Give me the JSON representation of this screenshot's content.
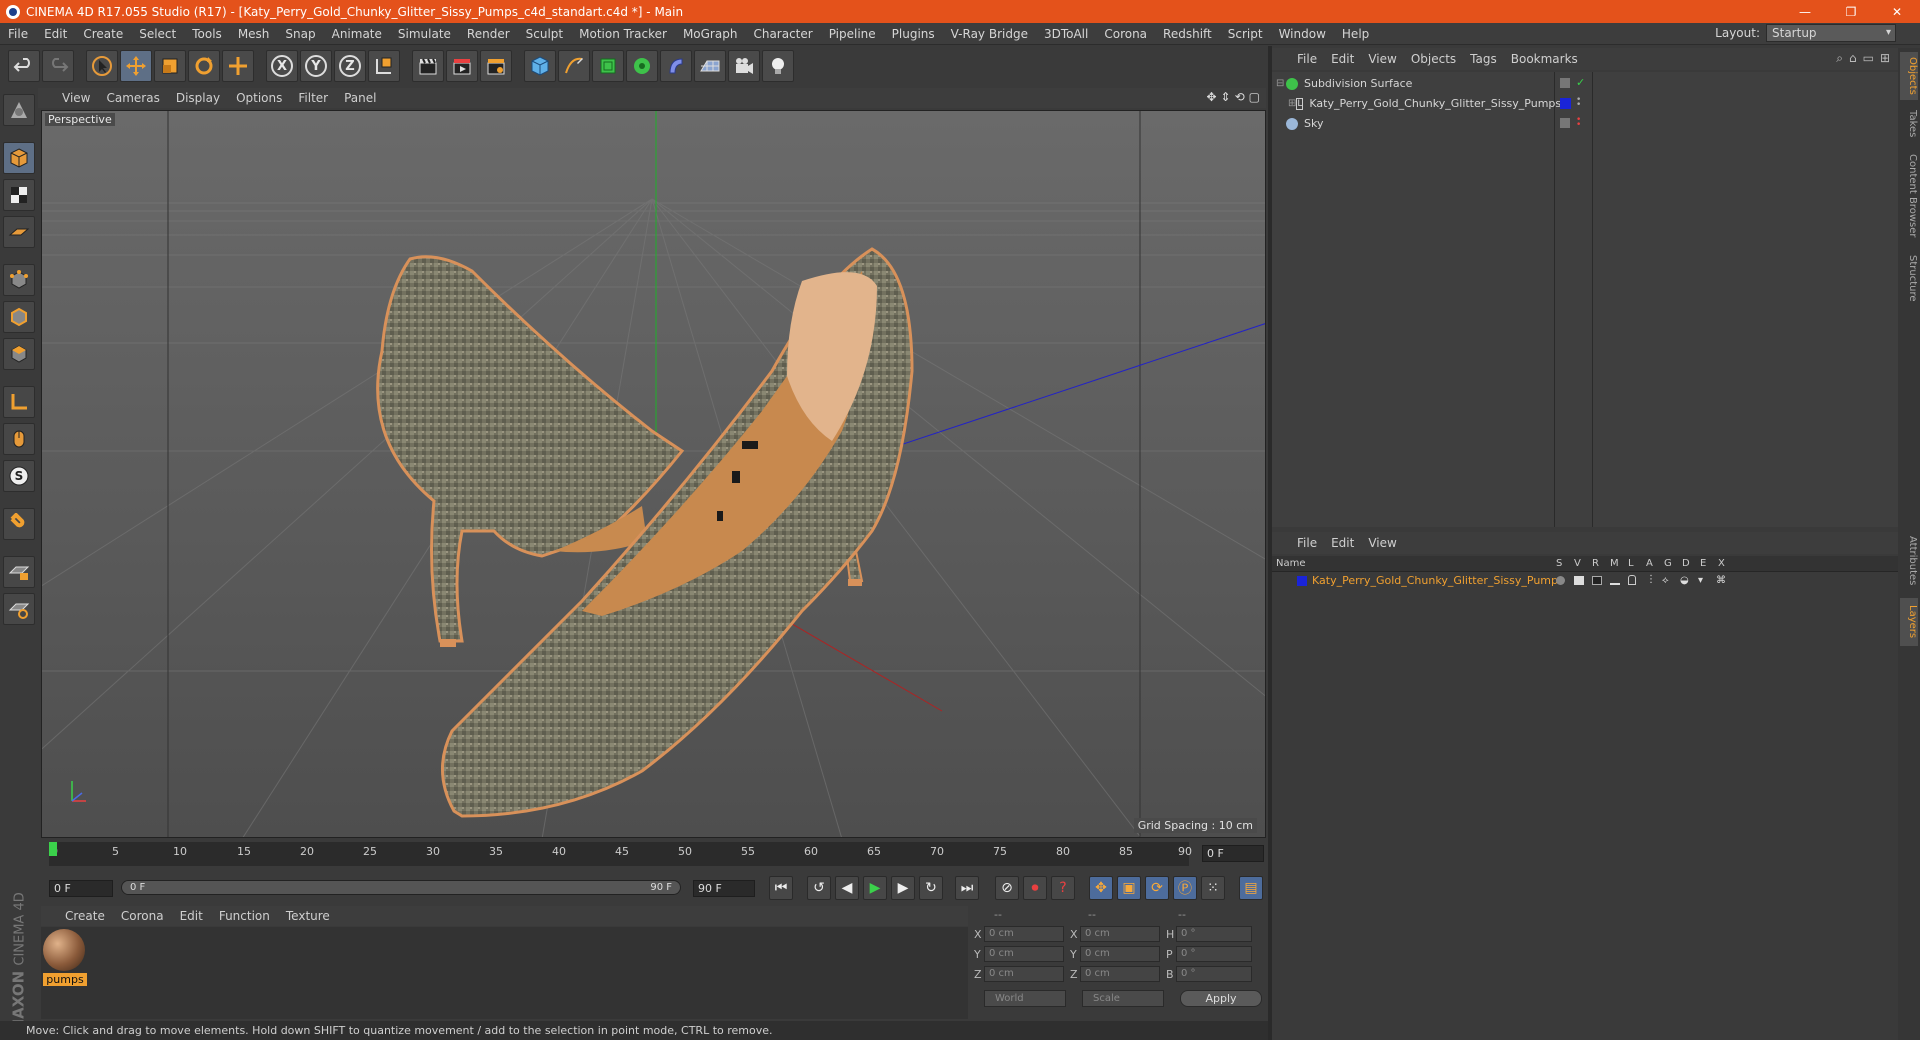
{
  "window": {
    "title": "CINEMA 4D R17.055 Studio (R17) - [Katy_Perry_Gold_Chunky_Glitter_Sissy_Pumps_c4d_standart.c4d *] - Main",
    "minimize": "—",
    "maximize": "❐",
    "close": "✕"
  },
  "menu": [
    "File",
    "Edit",
    "Create",
    "Select",
    "Tools",
    "Mesh",
    "Snap",
    "Animate",
    "Simulate",
    "Render",
    "Sculpt",
    "Motion Tracker",
    "MoGraph",
    "Character",
    "Pipeline",
    "Plugins",
    "V-Ray Bridge",
    "3DToAll",
    "Corona",
    "Redshift",
    "Script",
    "Window",
    "Help"
  ],
  "layout": {
    "label": "Layout:",
    "value": "Startup"
  },
  "toolbar": {
    "axis_x": "X",
    "axis_y": "Y",
    "axis_z": "Z"
  },
  "viewport": {
    "menu": [
      "View",
      "Cameras",
      "Display",
      "Options",
      "Filter",
      "Panel"
    ],
    "camera_label": "Perspective",
    "grid_spacing": "Grid Spacing : 10 cm"
  },
  "timeline": {
    "ticks": [
      "0",
      "5",
      "10",
      "15",
      "20",
      "25",
      "30",
      "35",
      "40",
      "45",
      "50",
      "55",
      "60",
      "65",
      "70",
      "75",
      "80",
      "85",
      "90"
    ],
    "current_frame": "0 F",
    "start_frame": "0 F",
    "range_start": "0 F",
    "range_end": "90 F",
    "end_frame": "90 F"
  },
  "material_manager": {
    "menu": [
      "Create",
      "Corona",
      "Edit",
      "Function",
      "Texture"
    ],
    "materials": [
      {
        "name": "pumps"
      }
    ]
  },
  "coordinates": {
    "headers": [
      "--",
      "--",
      "--"
    ],
    "rows": [
      {
        "l1": "X",
        "v1": "0 cm",
        "l2": "X",
        "v2": "0 cm",
        "l3": "H",
        "v3": "0 °"
      },
      {
        "l1": "Y",
        "v1": "0 cm",
        "l2": "Y",
        "v2": "0 cm",
        "l3": "P",
        "v3": "0 °"
      },
      {
        "l1": "Z",
        "v1": "0 cm",
        "l2": "Z",
        "v2": "0 cm",
        "l3": "B",
        "v3": "0 °"
      }
    ],
    "space": "World",
    "mode": "Scale",
    "apply": "Apply"
  },
  "status": "Move: Click and drag to move elements. Hold down SHIFT to quantize movement / add to the selection in point mode, CTRL to remove.",
  "logo": {
    "line1": "MAXON",
    "line2": "CINEMA 4D"
  },
  "object_manager": {
    "menu": [
      "File",
      "Edit",
      "View",
      "Objects",
      "Tags",
      "Bookmarks"
    ],
    "objects": [
      {
        "name": "Subdivision Surface",
        "icon_color": "#3ec24a"
      },
      {
        "name": "Katy_Perry_Gold_Chunky_Glitter_Sissy_Pumps",
        "icon_color": "#c8c8c8"
      },
      {
        "name": "Sky",
        "icon_color": "#9bb7d8"
      }
    ]
  },
  "layer_manager": {
    "menu": [
      "File",
      "Edit",
      "View"
    ],
    "columns": [
      "Name",
      "S",
      "V",
      "R",
      "M",
      "L",
      "A",
      "G",
      "D",
      "E",
      "X"
    ],
    "layers": [
      {
        "name": "Katy_Perry_Gold_Chunky_Glitter_Sissy_Pumps",
        "color": "#1a24d8"
      }
    ]
  },
  "side_tabs": [
    "Objects",
    "Takes",
    "Content Browser",
    "Structure",
    "Attributes",
    "Layers"
  ]
}
